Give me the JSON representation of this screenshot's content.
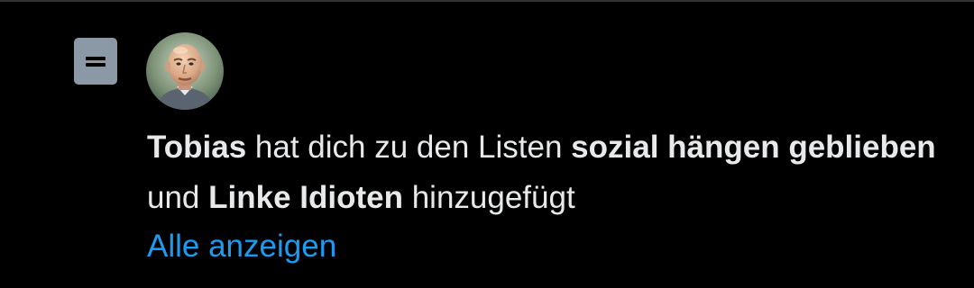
{
  "notification": {
    "icon": "list-icon",
    "avatar": {
      "icon": "user-avatar"
    },
    "message": {
      "actor": "Tobias",
      "text_1": " hat dich zu den Listen ",
      "list_1": "sozial hängen geblieben",
      "text_2": " und ",
      "list_2": "Linke Idioten",
      "text_3": " hinzugefügt"
    },
    "show_all_label": "Alle anzeigen"
  },
  "colors": {
    "background": "#000000",
    "text": "#e7e9ea",
    "link": "#1d9bf0",
    "icon_bg": "#8b98a5",
    "divider": "#2f3336"
  }
}
